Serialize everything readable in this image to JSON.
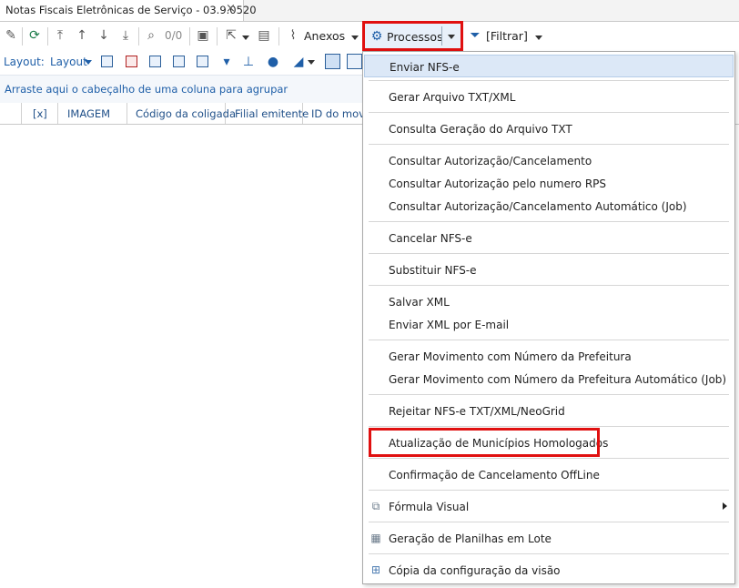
{
  "tab": {
    "title": "Notas Fiscais Eletrônicas de Serviço - 03.9.0520",
    "close": "×"
  },
  "toolbar": {
    "icons": [
      "pencil-icon",
      "refresh-icon",
      "first-icon",
      "up-icon",
      "down-icon",
      "last-icon",
      "search-icon"
    ],
    "counter": "0/0",
    "anexos_label": "Anexos",
    "processos_label": "Processos",
    "filtrar_label": "[Filtrar]"
  },
  "layout_bar": {
    "label": "Layout:",
    "dropdown": "Layout"
  },
  "group_panel": {
    "text": "Arraste aqui o cabeçalho de uma coluna para agrupar"
  },
  "grid": {
    "columns": [
      "[x]",
      "IMAGEM",
      "Código da coligada",
      "Filial emitente",
      "ID do movin"
    ]
  },
  "menu": {
    "items": [
      {
        "label": "Enviar NFS-e"
      },
      {
        "label": "Gerar Arquivo TXT/XML"
      },
      {
        "label": "Consulta Geração do Arquivo TXT"
      },
      {
        "label": "Consultar Autorização/Cancelamento"
      },
      {
        "label": "Consultar Autorização pelo numero RPS"
      },
      {
        "label": "Consultar Autorização/Cancelamento Automático (Job)"
      },
      {
        "label": "Cancelar NFS-e"
      },
      {
        "label": "Substituir NFS-e"
      },
      {
        "label": "Salvar XML"
      },
      {
        "label": "Enviar XML por E-mail"
      },
      {
        "label": "Gerar Movimento com Número da Prefeitura"
      },
      {
        "label": "Gerar Movimento com Número da Prefeitura Automático (Job)"
      },
      {
        "label": "Rejeitar NFS-e TXT/XML/NeoGrid"
      },
      {
        "label": "Atualização de Municípios Homologados"
      },
      {
        "label": "Confirmação de Cancelamento OffLine"
      },
      {
        "label": "Fórmula Visual",
        "icon": "diagram-icon"
      },
      {
        "label": "Geração de Planilhas em Lote",
        "icon": "spreadsheet-icon"
      },
      {
        "label": "Cópia da configuração da visão",
        "icon": "grid-copy-icon"
      }
    ]
  },
  "colors": {
    "accent": "#1f5fa8",
    "highlight": "#e01010",
    "hover": "#dce8f7"
  }
}
